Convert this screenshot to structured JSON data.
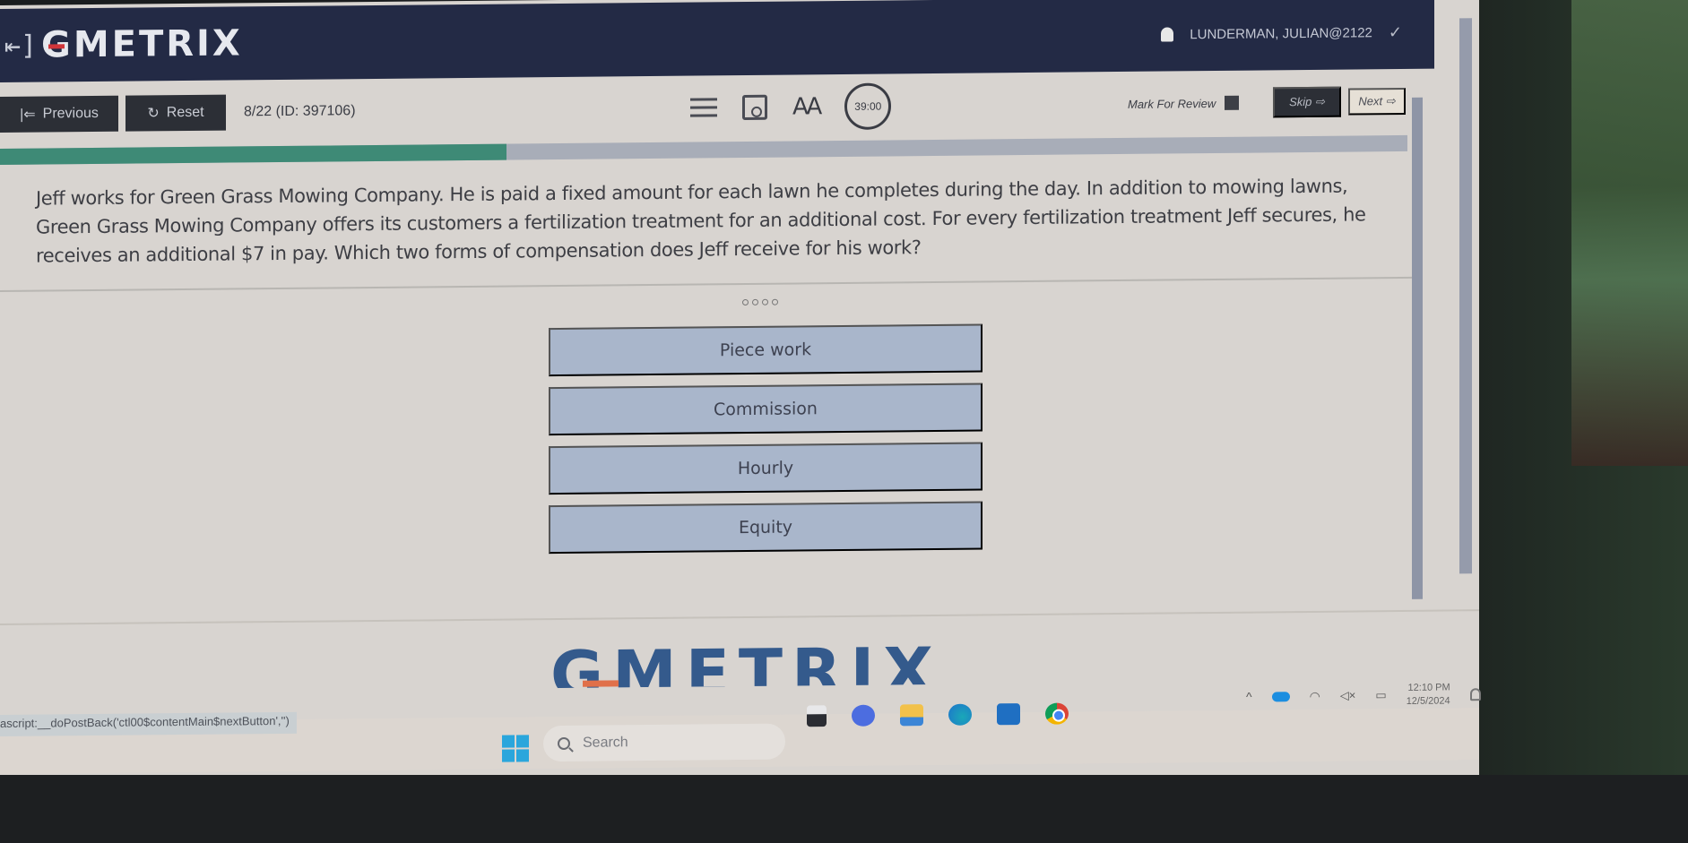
{
  "header": {
    "logo": "GMETRIX",
    "user": "LUNDERMAN, JULIAN@2122"
  },
  "toolbar": {
    "previous_label": "Previous",
    "reset_label": "Reset",
    "question_number": "8/22 (ID: 397106)",
    "font_size_label": "AA",
    "timer": "39:00",
    "mark_review_label": "Mark For Review",
    "skip_label": "Skip ⇨",
    "next_label": "Next ⇨"
  },
  "progress": {
    "fraction": 0.36
  },
  "question": {
    "text": "Jeff works for Green Grass Mowing Company. He is paid a fixed amount for each lawn he completes during the day. In addition to mowing lawns, Green Grass Mowing Company offers its customers a fertilization treatment for an additional cost. For every fertilization treatment Jeff secures, he receives an additional $7 in pay. Which two forms of compensation does Jeff receive for his work?",
    "answer_count": 4
  },
  "answers": [
    {
      "label": "Piece work"
    },
    {
      "label": "Commission"
    },
    {
      "label": "Hourly"
    },
    {
      "label": "Equity"
    }
  ],
  "footer": {
    "logo": "GMETRIX"
  },
  "status_bar": {
    "url": "ascript:__doPostBack('ctl00$contentMain$nextButton','')"
  },
  "taskbar": {
    "search_placeholder": "Search",
    "time": "12:10 PM",
    "date": "12/5/2024"
  }
}
